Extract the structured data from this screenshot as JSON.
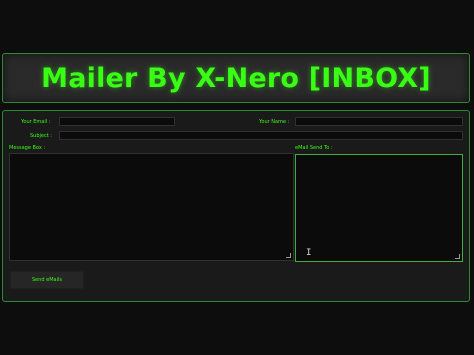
{
  "header": {
    "title": "Mailer By X-Nero [INBOX]"
  },
  "form": {
    "your_email_label": "Your Email :",
    "your_email_value": "",
    "your_name_label": "Your Name :",
    "your_name_value": "",
    "subject_label": "Subject :",
    "subject_value": "",
    "message_label": "Message Box :",
    "message_value": "",
    "send_to_label": "eMail Send To :",
    "send_to_value": "",
    "send_button": "Send eMails"
  },
  "colors": {
    "accent": "#39ff14",
    "border": "#2e8a2e",
    "background": "#0d0d0d",
    "panel": "#1a1a1a",
    "field": "#0b0b0b"
  },
  "icons": [
    "resize-grip-icon",
    "text-cursor-icon"
  ]
}
